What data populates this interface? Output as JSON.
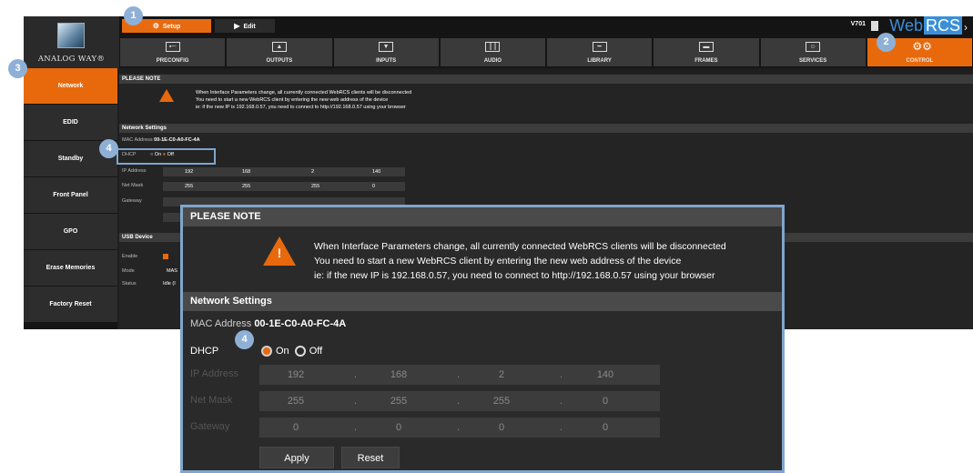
{
  "brand": "ANALOG WAY®",
  "topbar": {
    "setup_label": "Setup",
    "edit_label": "Edit",
    "version": "V701",
    "product_web": "Web",
    "product_rcs": "RCS",
    "more": "›"
  },
  "nav": [
    {
      "label": "PRECONFIG",
      "icon": "preconfig-icon",
      "glyph": "▪─"
    },
    {
      "label": "OUTPUTS",
      "icon": "outputs-icon",
      "glyph": "▲"
    },
    {
      "label": "INPUTS",
      "icon": "inputs-icon",
      "glyph": "▼"
    },
    {
      "label": "AUDIO",
      "icon": "audio-icon",
      "glyph": "║║"
    },
    {
      "label": "LIBRARY",
      "icon": "library-icon",
      "glyph": "━"
    },
    {
      "label": "FRAMES",
      "icon": "frames-icon",
      "glyph": "▬"
    },
    {
      "label": "SERVICES",
      "icon": "services-icon",
      "glyph": "☺"
    },
    {
      "label": "CONTROL",
      "icon": "gears-icon",
      "glyph": "⚙⚙"
    }
  ],
  "sidebar": [
    "Network",
    "EDID",
    "Standby",
    "Front Panel",
    "GPO",
    "Erase Memories",
    "Factory Reset"
  ],
  "note": {
    "title": "PLEASE NOTE",
    "line1": "When Interface Parameters change, all currently connected WebRCS clients will be disconnected",
    "line2": "You need to start a new WebRCS client by entering the new web address of the device",
    "line3": "ie: if the new IP is 192.168.0.57, you need to connect to http://192.168.0.57 using your browser"
  },
  "network": {
    "title": "Network Settings",
    "mac_label": "MAC Address",
    "mac_value": "00-1E-C0-A0-FC-4A",
    "dhcp_label": "DHCP",
    "dhcp_on": "On",
    "dhcp_off": "Off",
    "ip_label": "IP Address",
    "mask_label": "Net Mask",
    "gateway_label": "Gateway",
    "ip": [
      "192",
      "168",
      "2",
      "140"
    ],
    "mask": [
      "255",
      "255",
      "255",
      "0"
    ],
    "gateway": [
      "0",
      "0",
      "0",
      "0"
    ],
    "apply": "Apply",
    "reset": "Reset"
  },
  "usb": {
    "title": "USB Device",
    "enable_label": "Enable",
    "mode_label": "Mode",
    "mode_value": "MAS",
    "status_label": "Status",
    "status_value": "Idle (I"
  },
  "badges": [
    "1",
    "2",
    "3",
    "4",
    "4",
    "4"
  ],
  "colors": {
    "accent": "#e8690c",
    "callout": "#7fa6cc",
    "badge": "#8fb0d6",
    "brand_blue": "#3a8fd8"
  }
}
